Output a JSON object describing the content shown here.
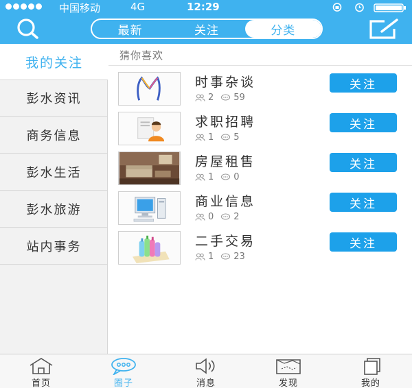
{
  "status_bar": {
    "carrier": "中国移动",
    "network": "4G",
    "time": "12:29"
  },
  "nav": {
    "search_icon": "search-icon",
    "compose_icon": "compose-icon",
    "segments": [
      {
        "label": "最新",
        "active": false
      },
      {
        "label": "关注",
        "active": false
      },
      {
        "label": "分类",
        "active": true
      }
    ]
  },
  "sidebar": {
    "items": [
      {
        "label": "我的关注",
        "active": true
      },
      {
        "label": "彭水资讯",
        "active": false
      },
      {
        "label": "商务信息",
        "active": false
      },
      {
        "label": "彭水生活",
        "active": false
      },
      {
        "label": "彭水旅游",
        "active": false
      },
      {
        "label": "站内事务",
        "active": false
      }
    ]
  },
  "main": {
    "section_title": "猜你喜欢",
    "follow_label": "关注",
    "items": [
      {
        "title": "时事杂谈",
        "members": "2",
        "posts": "59",
        "thumb": "m-logo"
      },
      {
        "title": "求职招聘",
        "members": "1",
        "posts": "5",
        "thumb": "job-seeker"
      },
      {
        "title": "房屋租售",
        "members": "1",
        "posts": "0",
        "thumb": "living-room"
      },
      {
        "title": "商业信息",
        "members": "0",
        "posts": "2",
        "thumb": "computer"
      },
      {
        "title": "二手交易",
        "members": "1",
        "posts": "23",
        "thumb": "bottles"
      }
    ]
  },
  "tabbar": {
    "tabs": [
      {
        "label": "首页",
        "icon": "home-icon",
        "active": false
      },
      {
        "label": "圈子",
        "icon": "chat-bubble-icon",
        "active": true
      },
      {
        "label": "消息",
        "icon": "speaker-icon",
        "active": false
      },
      {
        "label": "发现",
        "icon": "map-icon",
        "active": false
      },
      {
        "label": "我的",
        "icon": "profile-cards-icon",
        "active": false
      }
    ]
  },
  "colors": {
    "accent": "#3fb2ef",
    "button": "#1da1ea"
  }
}
